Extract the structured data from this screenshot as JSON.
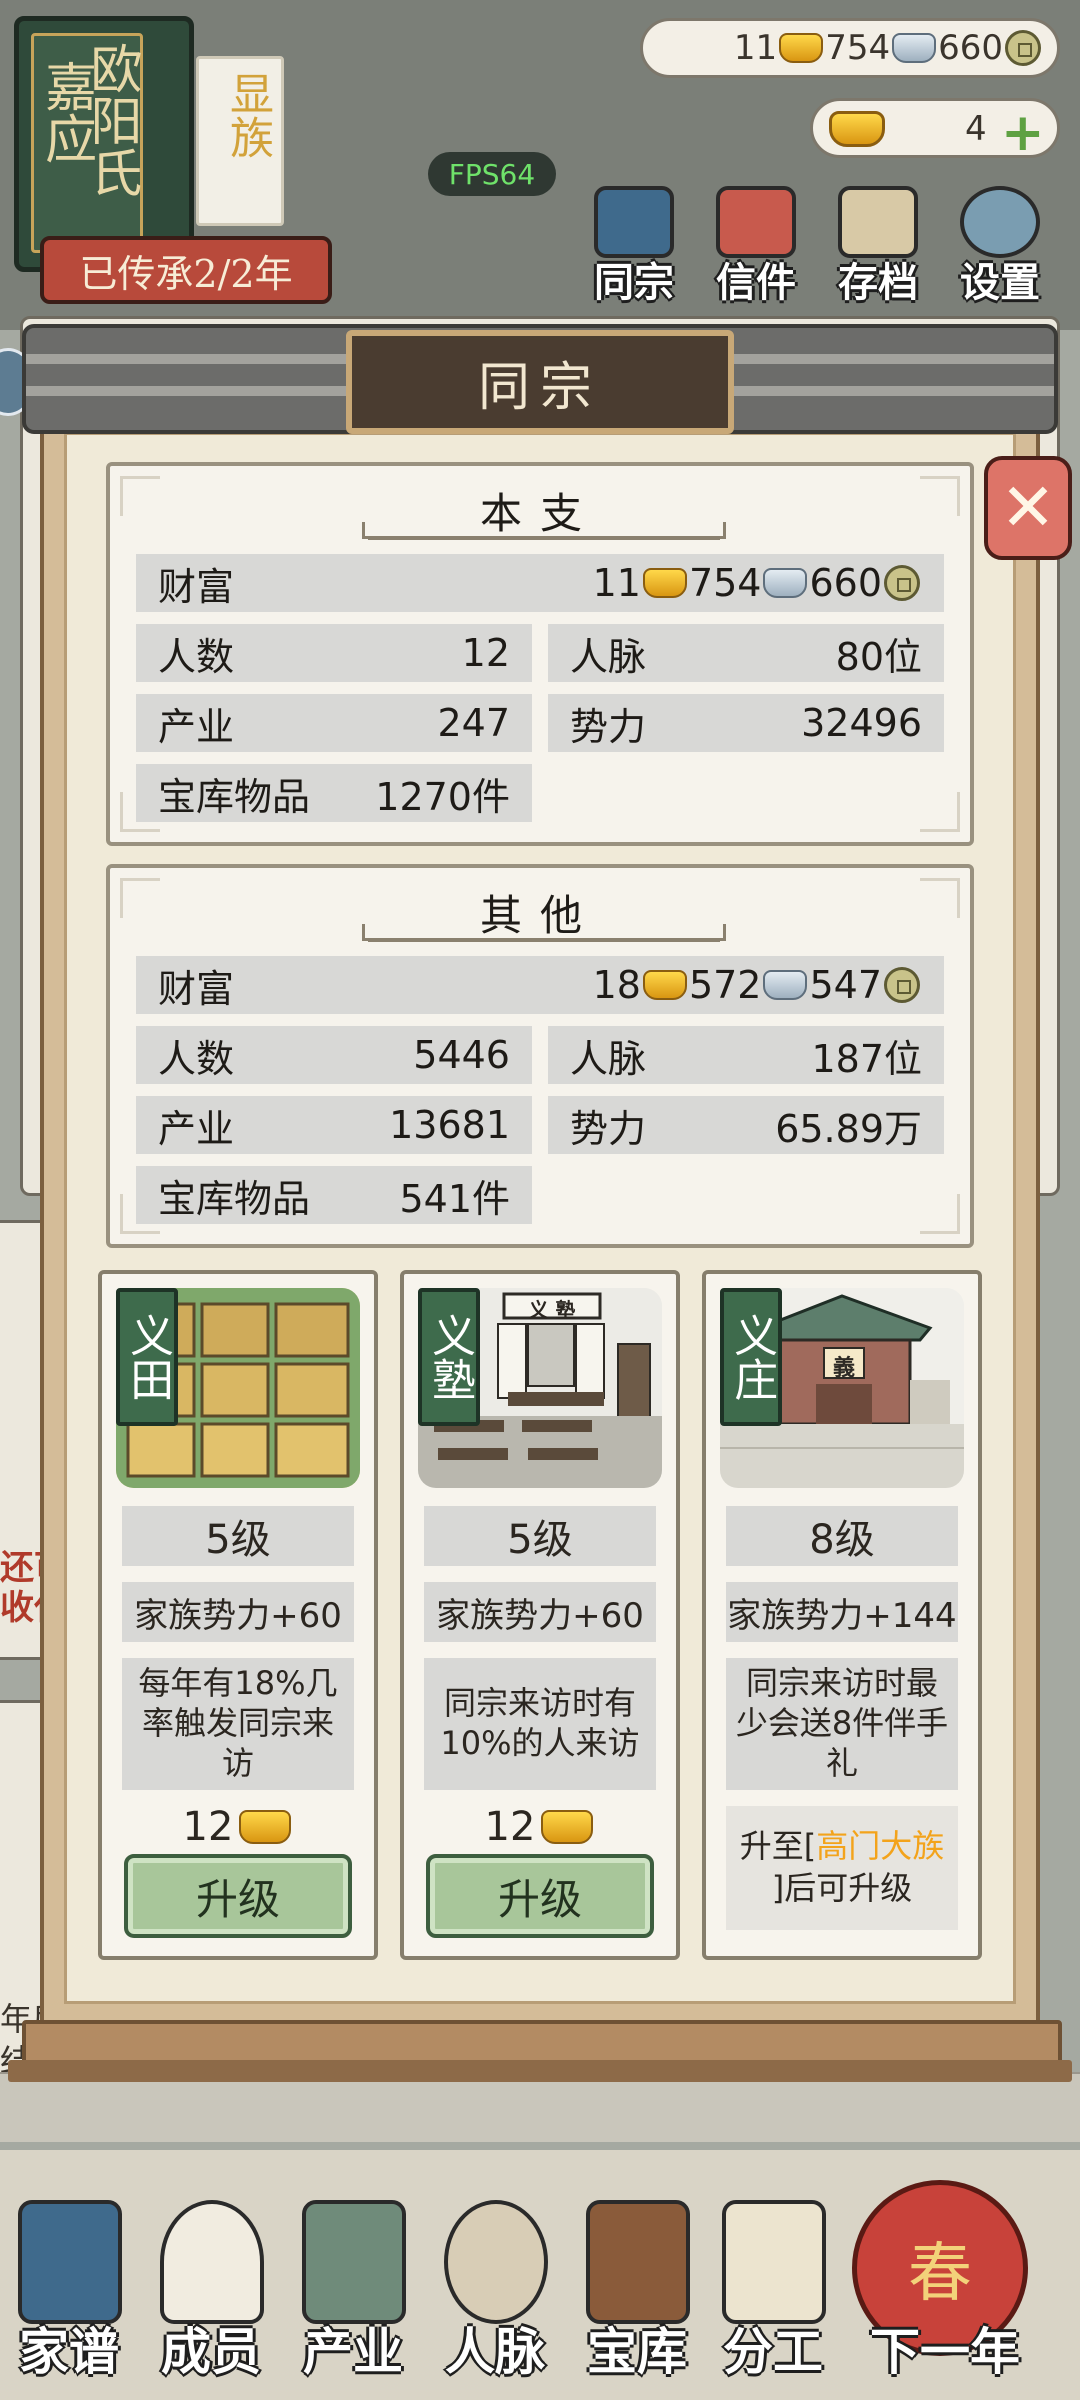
{
  "clan": {
    "surname": "欧阳氏",
    "given": "嘉应",
    "badge": "显族",
    "inherit": "已传承2/2年"
  },
  "resources": {
    "gold": "11",
    "silver": "754",
    "copper": "660",
    "premium_count": "4"
  },
  "fps": "FPS64",
  "top_menu": [
    {
      "label": "同宗",
      "icon": "clan-book-icon"
    },
    {
      "label": "信件",
      "icon": "letter-icon"
    },
    {
      "label": "存档",
      "icon": "save-scroll-icon"
    },
    {
      "label": "设置",
      "icon": "gear-icon"
    }
  ],
  "dialog": {
    "title": "同宗",
    "close_icon": "close-x-icon"
  },
  "main_branch": {
    "title": "本支",
    "wealth_label": "财富",
    "wealth_gold": "11",
    "wealth_silver": "754",
    "wealth_copper": "660",
    "people_label": "人数",
    "people": "12",
    "network_label": "人脉",
    "network": "80位",
    "industry_label": "产业",
    "industry": "247",
    "power_label": "势力",
    "power": "32496",
    "treasury_label": "宝库物品",
    "treasury": "1270件"
  },
  "others": {
    "title": "其他",
    "wealth_label": "财富",
    "wealth_gold": "18",
    "wealth_silver": "572",
    "wealth_copper": "547",
    "people_label": "人数",
    "people": "5446",
    "network_label": "人脉",
    "network": "187位",
    "industry_label": "产业",
    "industry": "13681",
    "power_label": "势力",
    "power": "65.89万",
    "treasury_label": "宝库物品",
    "treasury": "541件"
  },
  "buildings": [
    {
      "tag": "义田",
      "level": "5级",
      "bonus": "家族势力+60",
      "desc": "每年有18%几率触发同宗来访",
      "cost": "12",
      "button": "升级"
    },
    {
      "tag": "义塾",
      "sign": "义 塾",
      "level": "5级",
      "bonus": "家族势力+60",
      "desc": "同宗来访时有10%的人来访",
      "cost": "12",
      "button": "升级"
    },
    {
      "tag": "义庄",
      "sign": "義",
      "level": "8级",
      "bonus": "家族势力+144",
      "desc": "同宗来访时最少会送8件伴手礼",
      "note_pre": "升至[",
      "note_highlight": "高门大族",
      "note_post": "]后可升级"
    }
  ],
  "background_text": {
    "left_a": "还可",
    "left_b": "收任",
    "left_c": "年后",
    "left_d": "结"
  },
  "bottom_nav": [
    {
      "label": "家谱",
      "icon": "genealogy-book-icon"
    },
    {
      "label": "成员",
      "icon": "member-portrait-icon"
    },
    {
      "label": "产业",
      "icon": "building-icon"
    },
    {
      "label": "人脉",
      "icon": "network-icon"
    },
    {
      "label": "宝库",
      "icon": "treasure-chest-icon"
    },
    {
      "label": "分工",
      "icon": "scroll-icon"
    }
  ],
  "next_year": {
    "label": "下一年",
    "badge": "春"
  }
}
